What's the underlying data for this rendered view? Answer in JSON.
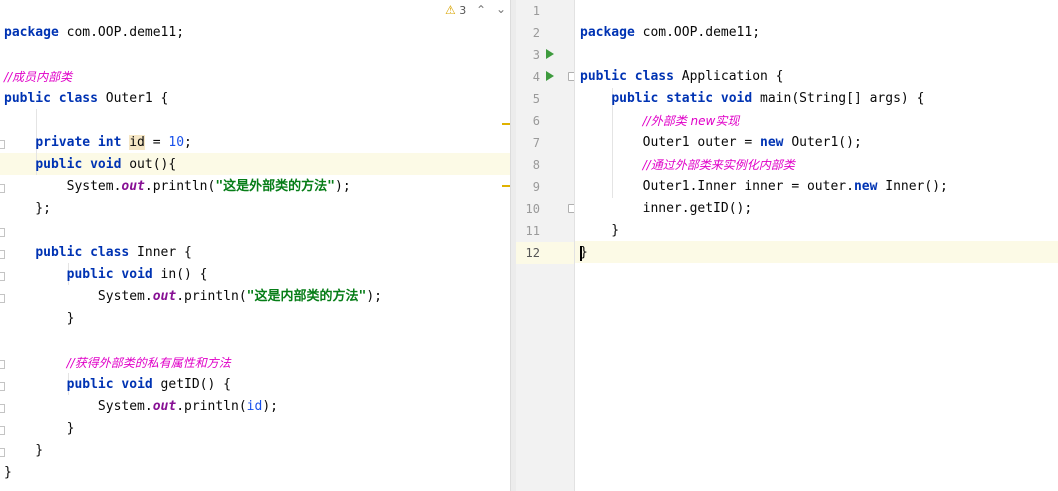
{
  "editor_left": {
    "warnings": {
      "icon": "warning-triangle-icon",
      "count": "3",
      "color": "#d9a400"
    },
    "lines": [
      "package com.OOP.deme11;",
      "",
      "//成员内部类",
      "public class Outer1 {",
      "",
      "private int id = 10;",
      "public void out(){",
      "System.out.println(\"这是外部类的方法\");",
      "};",
      "",
      "public class Inner {",
      "public void in() {",
      "System.out.println(\"这是内部类的方法\");",
      "}",
      "",
      "//获得外部类的私有属性和方法",
      "public void getID() {",
      "System.out.println(id);",
      "}",
      "}",
      "}"
    ]
  },
  "editor_right": {
    "line_numbers": [
      "1",
      "2",
      "3",
      "4",
      "5",
      "6",
      "7",
      "8",
      "9",
      "10",
      "11",
      "12"
    ],
    "current_line": "12",
    "lines": [
      "package com.OOP.deme11;",
      "",
      "public class Application {",
      "public static void main(String[] args) {",
      "//外部类 new实现",
      "Outer1 outer = new Outer1();",
      "//通过外部类来实例化内部类",
      "Outer1.Inner inner = outer.new Inner();",
      "inner.getID();",
      "}",
      "}",
      ""
    ]
  },
  "colors": {
    "keyword": "#0033b3",
    "string": "#067d17",
    "number": "#1750eb",
    "comment": "#e000c8",
    "static_field": "#871094",
    "current_line_bg": "#fcfae6",
    "run_gutter_icon": "#3e9b3e"
  }
}
